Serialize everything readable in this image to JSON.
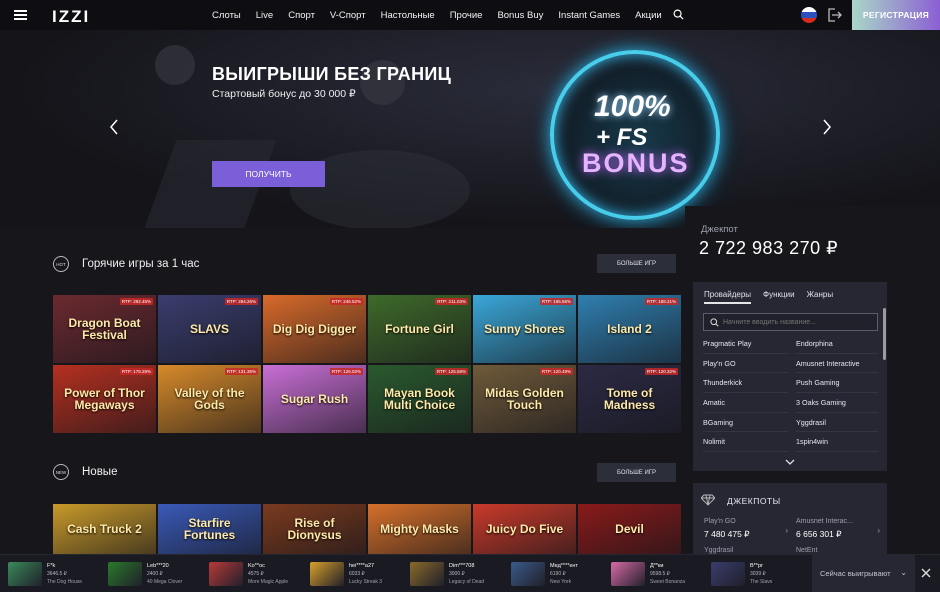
{
  "header": {
    "logo": "IZZI",
    "nav": [
      "Слоты",
      "Live",
      "Спорт",
      "V-Спорт",
      "Настольные",
      "Прочие",
      "Bonus Buy",
      "Instant Games",
      "Акции"
    ],
    "register_label": "РЕГИСТРАЦИЯ"
  },
  "hero": {
    "title": "ВЫИГРЫШИ БЕЗ ГРАНИЦ",
    "subtitle": "Стартовый бонус до 30 000 ₽",
    "button_label": "ПОЛУЧИТЬ",
    "art_line1": "100%",
    "art_line2": "+ FS",
    "art_line3": "BONUS"
  },
  "hot": {
    "icon_label": "HOT",
    "title": "Горячие игры за 1 час",
    "more_label": "БОЛЬШЕ ИГР",
    "games": [
      {
        "name": "Dragon Boat Festival",
        "rtp": "RTP: 292.45%",
        "bg": "#6b2a2f"
      },
      {
        "name": "SLAVS",
        "rtp": "RTP: 284.26%",
        "bg": "#3a3d6e"
      },
      {
        "name": "Dig Dig Digger",
        "rtp": "RTP: 246.52%",
        "bg": "#d86a2a"
      },
      {
        "name": "Fortune Girl",
        "rtp": "RTP: 211.03%",
        "bg": "#3e6a2a"
      },
      {
        "name": "Sunny Shores",
        "rtp": "RTP: 195.56%",
        "bg": "#3aa7d8"
      },
      {
        "name": "Island 2",
        "rtp": "RTP: 188.21%",
        "bg": "#2f7fb0"
      },
      {
        "name": "Power of Thor Megaways",
        "rtp": "RTP: 178.29%",
        "bg": "#b53020"
      },
      {
        "name": "Valley of the Gods",
        "rtp": "RTP: 131.35%",
        "bg": "#d78a2a"
      },
      {
        "name": "Sugar Rush",
        "rtp": "RTP: 126.02%",
        "bg": "#c96fd6"
      },
      {
        "name": "Mayan Book Multi Choice",
        "rtp": "RTP: 125.58%",
        "bg": "#2a5a2e"
      },
      {
        "name": "Midas Golden Touch",
        "rtp": "RTP: 120.49%",
        "bg": "#6f5a3a"
      },
      {
        "name": "Tome of Madness",
        "rtp": "RTP: 120.32%",
        "bg": "#2c2a44"
      }
    ]
  },
  "new": {
    "icon_label": "NEW",
    "title": "Новые",
    "more_label": "БОЛЬШЕ ИГР",
    "games": [
      {
        "name": "Cash Truck 2",
        "bg": "#c99a2a"
      },
      {
        "name": "Starfire Fortunes",
        "bg": "#3a5ab8"
      },
      {
        "name": "Rise of Dionysus",
        "bg": "#7a3a1e"
      },
      {
        "name": "Mighty Masks",
        "bg": "#d6702a"
      },
      {
        "name": "Juicy Do Five",
        "bg": "#c93a2a"
      },
      {
        "name": "Devil",
        "bg": "#8a1a1a"
      }
    ]
  },
  "jackpot": {
    "label": "Джекпот",
    "value": "2 722 983 270 ₽"
  },
  "providers": {
    "tabs": [
      "Провайдеры",
      "Функции",
      "Жанры"
    ],
    "search_placeholder": "Начните вводить название...",
    "items": [
      "Pragmatic Play",
      "Endorphina",
      "Play'n GO",
      "Amusnet Interactive",
      "Thunderkick",
      "Push Gaming",
      "Amatic",
      "3 Oaks Gaming",
      "BGaming",
      "Yggdrasil",
      "Nolimit",
      "1spin4win"
    ]
  },
  "jackpots": {
    "title": "ДЖЕКПОТЫ",
    "cards": [
      {
        "name": "Play'n GO",
        "value": "7 480 475 ₽"
      },
      {
        "name": "Amusnet Interac...",
        "value": "6 656 301 ₽"
      },
      {
        "name": "Yggdrasil",
        "value": ""
      },
      {
        "name": "NetEnt",
        "value": ""
      }
    ]
  },
  "wins": {
    "label": "Сейчас выигрывают",
    "items": [
      {
        "user": "F*k",
        "amount": "3646.5 ₽",
        "game": "The Dog House",
        "bg": "#3a8a5a"
      },
      {
        "user": "Leb***20",
        "amount": "2400 ₽",
        "game": "40 Mega Clover",
        "bg": "#2a7a2a"
      },
      {
        "user": "Ko**oc",
        "amount": "4575 ₽",
        "game": "More Magic Apple",
        "bg": "#b83a3a"
      },
      {
        "user": "hei****a27",
        "amount": "6033 ₽",
        "game": "Lucky Streak 3",
        "bg": "#d8a02a"
      },
      {
        "user": "Dim***708",
        "amount": "3000 ₽",
        "game": "Legacy of Dead",
        "bg": "#8a6a2a"
      },
      {
        "user": "Мед****ент",
        "amount": "6190 ₽",
        "game": "New York",
        "bg": "#3a5a8a"
      },
      {
        "user": "Д**ки",
        "amount": "9598.5 ₽",
        "game": "Sweet Bonanza",
        "bg": "#d86aa8"
      },
      {
        "user": "В**рг",
        "amount": "3039 ₽",
        "game": "The Slavs",
        "bg": "#3a3d6e"
      }
    ]
  }
}
